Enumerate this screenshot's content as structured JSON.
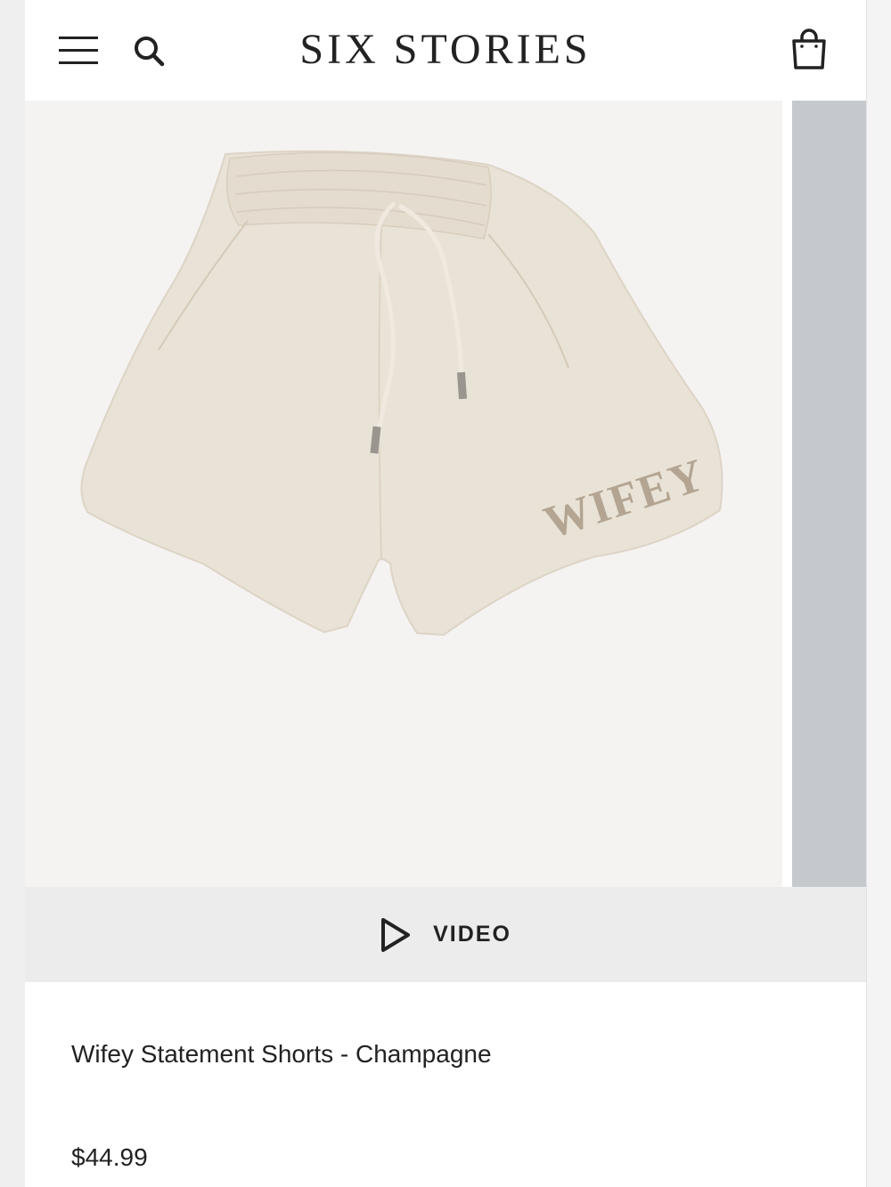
{
  "header": {
    "logo": "SIX STORIES",
    "icons": {
      "menu": "hamburger-menu-icon",
      "search": "search-icon",
      "cart": "shopping-bag-icon"
    }
  },
  "gallery": {
    "main_image_alt": "Wifey Statement Shorts - Champagne",
    "embroidery_text": "WIFEY",
    "colors": {
      "fabric": "#e9e2d6",
      "embroidery": "#b3a592",
      "next_slide": "#c5c9ce"
    }
  },
  "video": {
    "label": "VIDEO",
    "icon": "play-icon"
  },
  "product": {
    "title": "Wifey Statement Shorts - Champagne",
    "price": "$44.99"
  }
}
